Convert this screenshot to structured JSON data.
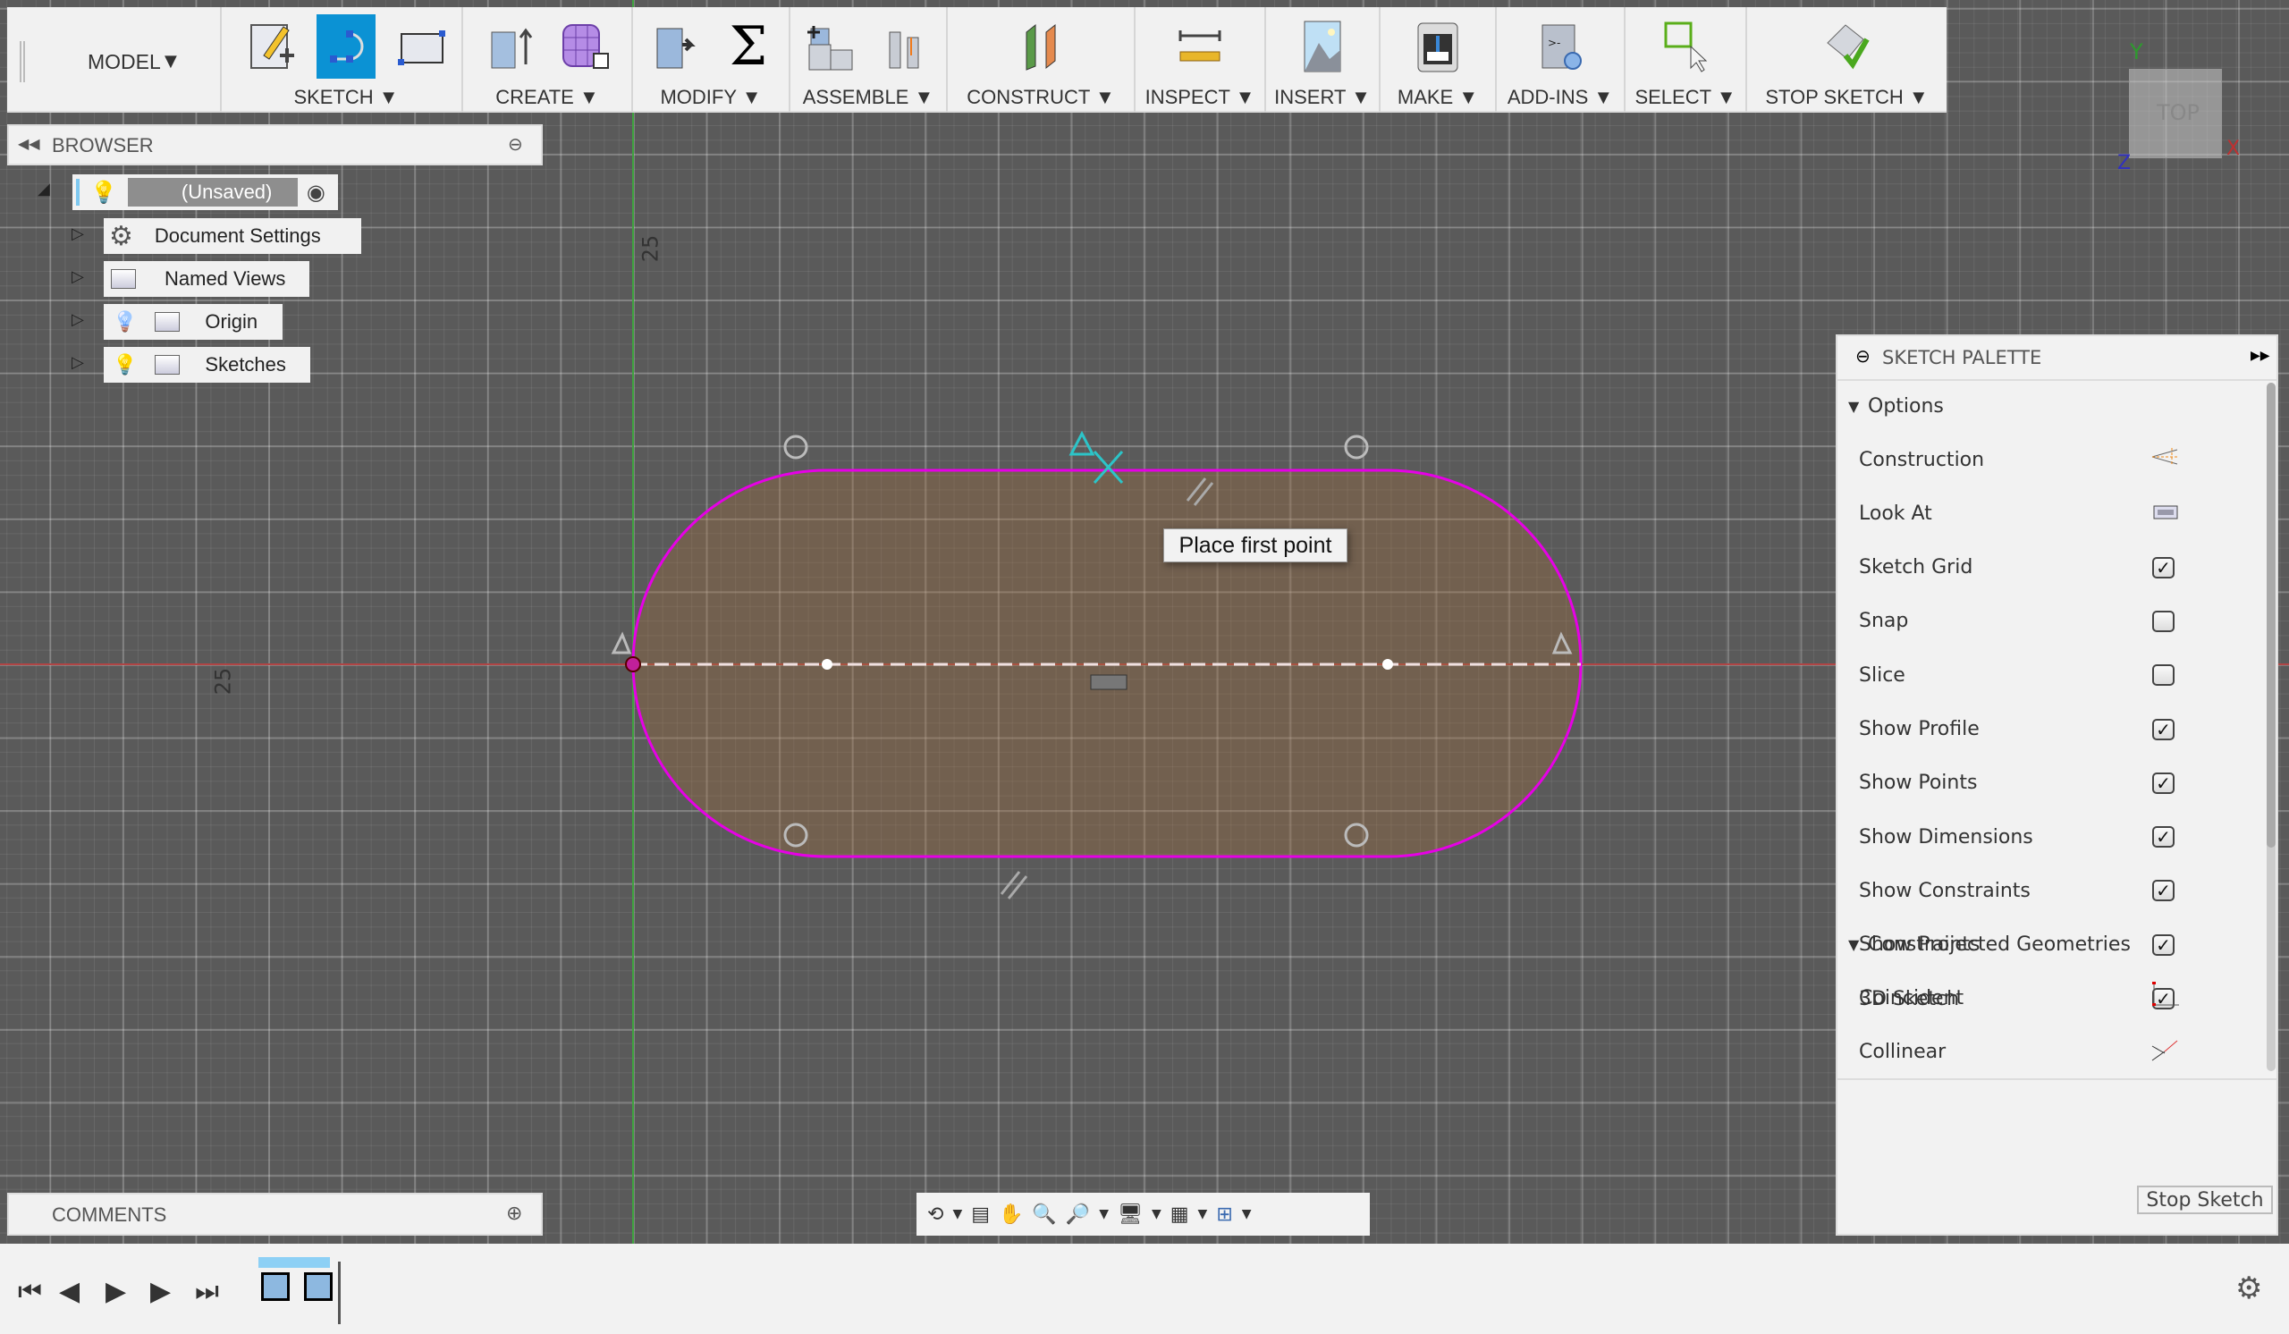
{
  "toolbar": {
    "workspace": "MODEL",
    "groups": [
      {
        "label": "SKETCH ▼",
        "icons": [
          "create-sketch-icon",
          "slot-icon",
          "rectangle-icon"
        ]
      },
      {
        "label": "CREATE ▼",
        "icons": [
          "extrude-icon",
          "form-icon"
        ]
      },
      {
        "label": "MODIFY ▼",
        "icons": [
          "press-pull-icon",
          "sigma-icon"
        ]
      },
      {
        "label": "ASSEMBLE ▼",
        "icons": [
          "new-component-icon",
          "joint-icon"
        ]
      },
      {
        "label": "CONSTRUCT ▼",
        "icons": [
          "offset-plane-icon"
        ]
      },
      {
        "label": "INSPECT ▼",
        "icons": [
          "measure-icon"
        ]
      },
      {
        "label": "INSERT ▼",
        "icons": [
          "insert-image-icon"
        ]
      },
      {
        "label": "MAKE ▼",
        "icons": [
          "3d-print-icon"
        ]
      },
      {
        "label": "ADD-INS ▼",
        "icons": [
          "scripts-icon"
        ]
      },
      {
        "label": "SELECT ▼",
        "icons": [
          "select-icon"
        ]
      },
      {
        "label": "STOP SKETCH ▼",
        "icons": [
          "stop-sketch-icon"
        ]
      }
    ]
  },
  "viewcube": {
    "face": "TOP",
    "x": "X",
    "y": "Y",
    "z": "Z"
  },
  "browser": {
    "title": "BROWSER",
    "root": "(Unsaved)",
    "items": [
      "Document Settings",
      "Named Views",
      "Origin",
      "Sketches"
    ]
  },
  "comments": {
    "title": "COMMENTS"
  },
  "canvas": {
    "tooltip": "Place first point",
    "dim_top": "25",
    "dim_left": "25"
  },
  "palette": {
    "title": "SKETCH PALETTE",
    "options_header": "Options",
    "options": [
      {
        "label": "Construction",
        "type": "icon",
        "icon": "construction-icon"
      },
      {
        "label": "Look At",
        "type": "icon",
        "icon": "look-at-icon"
      },
      {
        "label": "Sketch Grid",
        "type": "checkbox",
        "checked": true
      },
      {
        "label": "Snap",
        "type": "checkbox",
        "checked": false
      },
      {
        "label": "Slice",
        "type": "checkbox",
        "checked": false
      },
      {
        "label": "Show Profile",
        "type": "checkbox",
        "checked": true
      },
      {
        "label": "Show Points",
        "type": "checkbox",
        "checked": true
      },
      {
        "label": "Show Dimensions",
        "type": "checkbox",
        "checked": true
      },
      {
        "label": "Show Constraints",
        "type": "checkbox",
        "checked": true
      },
      {
        "label": "Show Projected Geometries",
        "type": "checkbox",
        "checked": true
      },
      {
        "label": "3D Sketch",
        "type": "checkbox",
        "checked": true
      }
    ],
    "constraints_header": "Constraints",
    "constraints": [
      {
        "label": "Coincident",
        "icon": "coincident-icon"
      },
      {
        "label": "Collinear",
        "icon": "collinear-icon"
      }
    ],
    "stop_button": "Stop Sketch"
  },
  "colors": {
    "accent": "#0b92d4",
    "sketch": "#e600e6",
    "profile": "#8a6e4e"
  }
}
